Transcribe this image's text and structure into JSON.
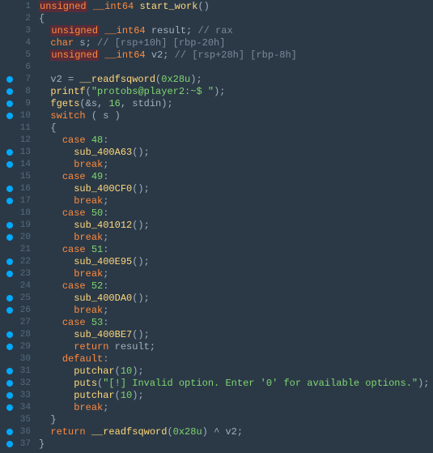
{
  "lines": [
    {
      "n": 1,
      "bp": false,
      "segs": [
        {
          "c": "kw-hl",
          "t": "unsigned"
        },
        {
          "c": "op",
          "t": " "
        },
        {
          "c": "type",
          "t": "__int64"
        },
        {
          "c": "op",
          "t": " "
        },
        {
          "c": "fn",
          "t": "start_work"
        },
        {
          "c": "pun",
          "t": "()"
        }
      ]
    },
    {
      "n": 2,
      "bp": false,
      "segs": [
        {
          "c": "pun",
          "t": "{"
        }
      ]
    },
    {
      "n": 3,
      "bp": false,
      "segs": [
        {
          "c": "op",
          "t": "  "
        },
        {
          "c": "kw-hl",
          "t": "unsigned"
        },
        {
          "c": "op",
          "t": " "
        },
        {
          "c": "type",
          "t": "__int64"
        },
        {
          "c": "op",
          "t": " result; "
        },
        {
          "c": "cmt",
          "t": "// rax"
        }
      ]
    },
    {
      "n": 4,
      "bp": false,
      "segs": [
        {
          "c": "op",
          "t": "  "
        },
        {
          "c": "type",
          "t": "char"
        },
        {
          "c": "op",
          "t": " s; "
        },
        {
          "c": "cmt",
          "t": "// [rsp+10h] [rbp-20h]"
        }
      ]
    },
    {
      "n": 5,
      "bp": false,
      "segs": [
        {
          "c": "op",
          "t": "  "
        },
        {
          "c": "kw-hl",
          "t": "unsigned"
        },
        {
          "c": "op",
          "t": " "
        },
        {
          "c": "type",
          "t": "__int64"
        },
        {
          "c": "op",
          "t": " v2; "
        },
        {
          "c": "cmt",
          "t": "// [rsp+28h] [rbp-8h]"
        }
      ]
    },
    {
      "n": 6,
      "bp": false,
      "segs": [
        {
          "c": "op",
          "t": ""
        }
      ]
    },
    {
      "n": 7,
      "bp": true,
      "segs": [
        {
          "c": "op",
          "t": "  v2 = "
        },
        {
          "c": "fn",
          "t": "__readfsqword"
        },
        {
          "c": "pun",
          "t": "("
        },
        {
          "c": "num",
          "t": "0x28u"
        },
        {
          "c": "pun",
          "t": ");"
        }
      ]
    },
    {
      "n": 8,
      "bp": true,
      "segs": [
        {
          "c": "op",
          "t": "  "
        },
        {
          "c": "fn",
          "t": "printf"
        },
        {
          "c": "pun",
          "t": "("
        },
        {
          "c": "str",
          "t": "\"protobs@player2:~$ \""
        },
        {
          "c": "pun",
          "t": ");"
        }
      ]
    },
    {
      "n": 9,
      "bp": true,
      "segs": [
        {
          "c": "op",
          "t": "  "
        },
        {
          "c": "fn",
          "t": "fgets"
        },
        {
          "c": "pun",
          "t": "(&s, "
        },
        {
          "c": "num",
          "t": "16"
        },
        {
          "c": "pun",
          "t": ", stdin);"
        }
      ]
    },
    {
      "n": 10,
      "bp": true,
      "segs": [
        {
          "c": "op",
          "t": "  "
        },
        {
          "c": "type",
          "t": "switch"
        },
        {
          "c": "op",
          "t": " ( s )"
        }
      ]
    },
    {
      "n": 11,
      "bp": false,
      "segs": [
        {
          "c": "op",
          "t": "  {"
        }
      ]
    },
    {
      "n": 12,
      "bp": false,
      "segs": [
        {
          "c": "op",
          "t": "    "
        },
        {
          "c": "type",
          "t": "case"
        },
        {
          "c": "op",
          "t": " "
        },
        {
          "c": "num",
          "t": "48"
        },
        {
          "c": "pun",
          "t": ":"
        }
      ]
    },
    {
      "n": 13,
      "bp": true,
      "segs": [
        {
          "c": "op",
          "t": "      "
        },
        {
          "c": "fn",
          "t": "sub_400A63"
        },
        {
          "c": "pun",
          "t": "();"
        }
      ]
    },
    {
      "n": 14,
      "bp": true,
      "segs": [
        {
          "c": "op",
          "t": "      "
        },
        {
          "c": "type",
          "t": "break"
        },
        {
          "c": "pun",
          "t": ";"
        }
      ]
    },
    {
      "n": 15,
      "bp": false,
      "segs": [
        {
          "c": "op",
          "t": "    "
        },
        {
          "c": "type",
          "t": "case"
        },
        {
          "c": "op",
          "t": " "
        },
        {
          "c": "num",
          "t": "49"
        },
        {
          "c": "pun",
          "t": ":"
        }
      ]
    },
    {
      "n": 16,
      "bp": true,
      "segs": [
        {
          "c": "op",
          "t": "      "
        },
        {
          "c": "fn",
          "t": "sub_400CF0"
        },
        {
          "c": "pun",
          "t": "();"
        }
      ]
    },
    {
      "n": 17,
      "bp": true,
      "segs": [
        {
          "c": "op",
          "t": "      "
        },
        {
          "c": "type",
          "t": "break"
        },
        {
          "c": "pun",
          "t": ";"
        }
      ]
    },
    {
      "n": 18,
      "bp": false,
      "segs": [
        {
          "c": "op",
          "t": "    "
        },
        {
          "c": "type",
          "t": "case"
        },
        {
          "c": "op",
          "t": " "
        },
        {
          "c": "num",
          "t": "50"
        },
        {
          "c": "pun",
          "t": ":"
        }
      ]
    },
    {
      "n": 19,
      "bp": true,
      "segs": [
        {
          "c": "op",
          "t": "      "
        },
        {
          "c": "fn",
          "t": "sub_401012"
        },
        {
          "c": "pun",
          "t": "();"
        }
      ]
    },
    {
      "n": 20,
      "bp": true,
      "segs": [
        {
          "c": "op",
          "t": "      "
        },
        {
          "c": "type",
          "t": "break"
        },
        {
          "c": "pun",
          "t": ";"
        }
      ]
    },
    {
      "n": 21,
      "bp": false,
      "segs": [
        {
          "c": "op",
          "t": "    "
        },
        {
          "c": "type",
          "t": "case"
        },
        {
          "c": "op",
          "t": " "
        },
        {
          "c": "num",
          "t": "51"
        },
        {
          "c": "pun",
          "t": ":"
        }
      ]
    },
    {
      "n": 22,
      "bp": true,
      "segs": [
        {
          "c": "op",
          "t": "      "
        },
        {
          "c": "fn",
          "t": "sub_400E95"
        },
        {
          "c": "pun",
          "t": "();"
        }
      ]
    },
    {
      "n": 23,
      "bp": true,
      "segs": [
        {
          "c": "op",
          "t": "      "
        },
        {
          "c": "type",
          "t": "break"
        },
        {
          "c": "pun",
          "t": ";"
        }
      ]
    },
    {
      "n": 24,
      "bp": false,
      "segs": [
        {
          "c": "op",
          "t": "    "
        },
        {
          "c": "type",
          "t": "case"
        },
        {
          "c": "op",
          "t": " "
        },
        {
          "c": "num",
          "t": "52"
        },
        {
          "c": "pun",
          "t": ":"
        }
      ]
    },
    {
      "n": 25,
      "bp": true,
      "segs": [
        {
          "c": "op",
          "t": "      "
        },
        {
          "c": "fn",
          "t": "sub_400DA0"
        },
        {
          "c": "pun",
          "t": "();"
        }
      ]
    },
    {
      "n": 26,
      "bp": true,
      "segs": [
        {
          "c": "op",
          "t": "      "
        },
        {
          "c": "type",
          "t": "break"
        },
        {
          "c": "pun",
          "t": ";"
        }
      ]
    },
    {
      "n": 27,
      "bp": false,
      "segs": [
        {
          "c": "op",
          "t": "    "
        },
        {
          "c": "type",
          "t": "case"
        },
        {
          "c": "op",
          "t": " "
        },
        {
          "c": "num",
          "t": "53"
        },
        {
          "c": "pun",
          "t": ":"
        }
      ]
    },
    {
      "n": 28,
      "bp": true,
      "segs": [
        {
          "c": "op",
          "t": "      "
        },
        {
          "c": "fn",
          "t": "sub_400BE7"
        },
        {
          "c": "pun",
          "t": "();"
        }
      ]
    },
    {
      "n": 29,
      "bp": true,
      "segs": [
        {
          "c": "op",
          "t": "      "
        },
        {
          "c": "type",
          "t": "return"
        },
        {
          "c": "op",
          "t": " result"
        },
        {
          "c": "pun",
          "t": ";"
        }
      ]
    },
    {
      "n": 30,
      "bp": false,
      "segs": [
        {
          "c": "op",
          "t": "    "
        },
        {
          "c": "type",
          "t": "default"
        },
        {
          "c": "pun",
          "t": ":"
        }
      ]
    },
    {
      "n": 31,
      "bp": true,
      "segs": [
        {
          "c": "op",
          "t": "      "
        },
        {
          "c": "fn",
          "t": "putchar"
        },
        {
          "c": "pun",
          "t": "("
        },
        {
          "c": "num",
          "t": "10"
        },
        {
          "c": "pun",
          "t": ");"
        }
      ]
    },
    {
      "n": 32,
      "bp": true,
      "segs": [
        {
          "c": "op",
          "t": "      "
        },
        {
          "c": "fn",
          "t": "puts"
        },
        {
          "c": "pun",
          "t": "("
        },
        {
          "c": "str",
          "t": "\"[!] Invalid option. Enter '0' for available options.\""
        },
        {
          "c": "pun",
          "t": ");"
        }
      ]
    },
    {
      "n": 33,
      "bp": true,
      "segs": [
        {
          "c": "op",
          "t": "      "
        },
        {
          "c": "fn",
          "t": "putchar"
        },
        {
          "c": "pun",
          "t": "("
        },
        {
          "c": "num",
          "t": "10"
        },
        {
          "c": "pun",
          "t": ");"
        }
      ]
    },
    {
      "n": 34,
      "bp": true,
      "segs": [
        {
          "c": "op",
          "t": "      "
        },
        {
          "c": "type",
          "t": "break"
        },
        {
          "c": "pun",
          "t": ";"
        }
      ]
    },
    {
      "n": 35,
      "bp": false,
      "segs": [
        {
          "c": "op",
          "t": "  }"
        }
      ]
    },
    {
      "n": 36,
      "bp": true,
      "segs": [
        {
          "c": "op",
          "t": "  "
        },
        {
          "c": "type",
          "t": "return"
        },
        {
          "c": "op",
          "t": " "
        },
        {
          "c": "fn",
          "t": "__readfsqword"
        },
        {
          "c": "pun",
          "t": "("
        },
        {
          "c": "num",
          "t": "0x28u"
        },
        {
          "c": "pun",
          "t": ") ^ v2;"
        }
      ]
    },
    {
      "n": 37,
      "bp": true,
      "segs": [
        {
          "c": "pun",
          "t": "}"
        }
      ]
    }
  ]
}
